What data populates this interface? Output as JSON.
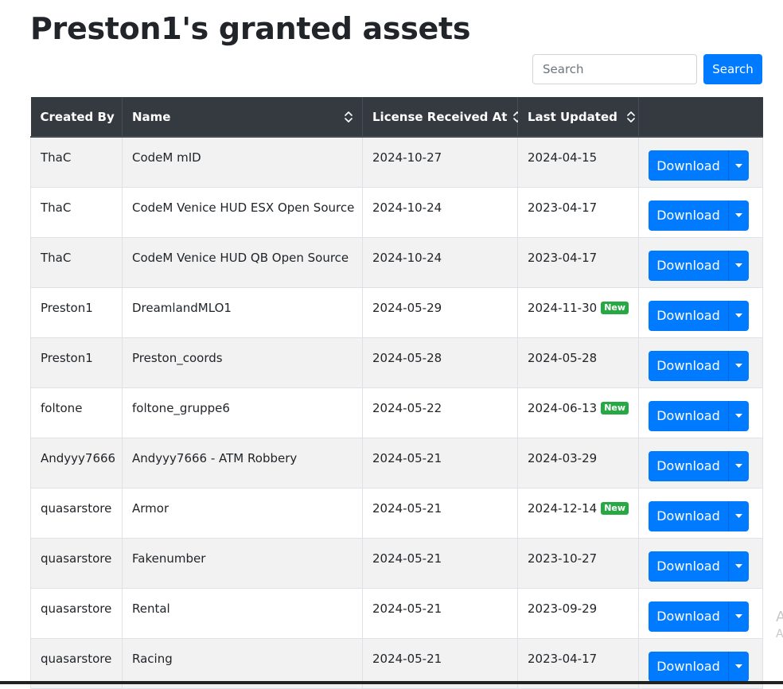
{
  "page": {
    "title": "Preston1's granted assets"
  },
  "search": {
    "placeholder": "Search",
    "button_label": "Search"
  },
  "table": {
    "headers": {
      "created_by": "Created By",
      "name": "Name",
      "license_received_at": "License Received At",
      "last_updated": "Last Updated"
    },
    "rows": [
      {
        "created_by": "ThaC",
        "name": "CodeM mID",
        "license_received_at": "2024-10-27",
        "last_updated": "2024-04-15",
        "is_new": false
      },
      {
        "created_by": "ThaC",
        "name": "CodeM Venice HUD ESX Open Source",
        "license_received_at": "2024-10-24",
        "last_updated": "2023-04-17",
        "is_new": false
      },
      {
        "created_by": "ThaC",
        "name": "CodeM Venice HUD QB Open Source",
        "license_received_at": "2024-10-24",
        "last_updated": "2023-04-17",
        "is_new": false
      },
      {
        "created_by": "Preston1",
        "name": "DreamlandMLO1",
        "license_received_at": "2024-05-29",
        "last_updated": "2024-11-30",
        "is_new": true
      },
      {
        "created_by": "Preston1",
        "name": "Preston_coords",
        "license_received_at": "2024-05-28",
        "last_updated": "2024-05-28",
        "is_new": false
      },
      {
        "created_by": "foltone",
        "name": "foltone_gruppe6",
        "license_received_at": "2024-05-22",
        "last_updated": "2024-06-13",
        "is_new": true
      },
      {
        "created_by": "Andyyy7666",
        "name": "Andyyy7666 - ATM Robbery",
        "license_received_at": "2024-05-21",
        "last_updated": "2024-03-29",
        "is_new": false
      },
      {
        "created_by": "quasarstore",
        "name": "Armor",
        "license_received_at": "2024-05-21",
        "last_updated": "2024-12-14",
        "is_new": true
      },
      {
        "created_by": "quasarstore",
        "name": "Fakenumber",
        "license_received_at": "2024-05-21",
        "last_updated": "2023-10-27",
        "is_new": false
      },
      {
        "created_by": "quasarstore",
        "name": "Rental",
        "license_received_at": "2024-05-21",
        "last_updated": "2023-09-29",
        "is_new": false
      },
      {
        "created_by": "quasarstore",
        "name": "Racing",
        "license_received_at": "2024-05-21",
        "last_updated": "2023-04-17",
        "is_new": false
      }
    ],
    "badge_new_label": "New",
    "download_label": "Download"
  },
  "edge_fragments": [
    "A",
    "A"
  ],
  "colors": {
    "primary": "#007bff",
    "header_bg": "#343a40",
    "badge_new": "#28a745",
    "row_stripe": "#f2f2f2"
  },
  "icons": {
    "sort": "sort-icon",
    "dropdown": "caret-down-icon"
  }
}
